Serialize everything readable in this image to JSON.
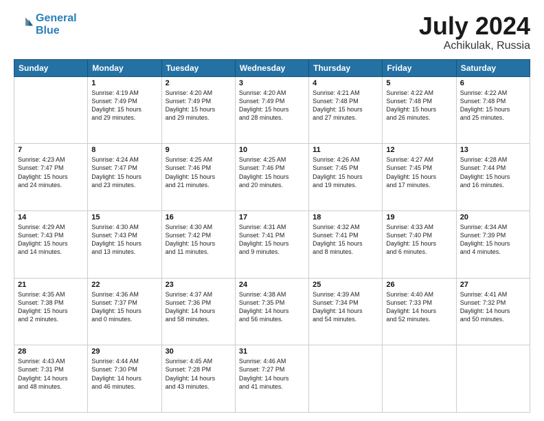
{
  "logo": {
    "line1": "General",
    "line2": "Blue"
  },
  "title": "July 2024",
  "subtitle": "Achikulak, Russia",
  "days_of_week": [
    "Sunday",
    "Monday",
    "Tuesday",
    "Wednesday",
    "Thursday",
    "Friday",
    "Saturday"
  ],
  "weeks": [
    [
      {
        "day": "",
        "info": ""
      },
      {
        "day": "1",
        "info": "Sunrise: 4:19 AM\nSunset: 7:49 PM\nDaylight: 15 hours\nand 29 minutes."
      },
      {
        "day": "2",
        "info": "Sunrise: 4:20 AM\nSunset: 7:49 PM\nDaylight: 15 hours\nand 29 minutes."
      },
      {
        "day": "3",
        "info": "Sunrise: 4:20 AM\nSunset: 7:49 PM\nDaylight: 15 hours\nand 28 minutes."
      },
      {
        "day": "4",
        "info": "Sunrise: 4:21 AM\nSunset: 7:48 PM\nDaylight: 15 hours\nand 27 minutes."
      },
      {
        "day": "5",
        "info": "Sunrise: 4:22 AM\nSunset: 7:48 PM\nDaylight: 15 hours\nand 26 minutes."
      },
      {
        "day": "6",
        "info": "Sunrise: 4:22 AM\nSunset: 7:48 PM\nDaylight: 15 hours\nand 25 minutes."
      }
    ],
    [
      {
        "day": "7",
        "info": "Sunrise: 4:23 AM\nSunset: 7:47 PM\nDaylight: 15 hours\nand 24 minutes."
      },
      {
        "day": "8",
        "info": "Sunrise: 4:24 AM\nSunset: 7:47 PM\nDaylight: 15 hours\nand 23 minutes."
      },
      {
        "day": "9",
        "info": "Sunrise: 4:25 AM\nSunset: 7:46 PM\nDaylight: 15 hours\nand 21 minutes."
      },
      {
        "day": "10",
        "info": "Sunrise: 4:25 AM\nSunset: 7:46 PM\nDaylight: 15 hours\nand 20 minutes."
      },
      {
        "day": "11",
        "info": "Sunrise: 4:26 AM\nSunset: 7:45 PM\nDaylight: 15 hours\nand 19 minutes."
      },
      {
        "day": "12",
        "info": "Sunrise: 4:27 AM\nSunset: 7:45 PM\nDaylight: 15 hours\nand 17 minutes."
      },
      {
        "day": "13",
        "info": "Sunrise: 4:28 AM\nSunset: 7:44 PM\nDaylight: 15 hours\nand 16 minutes."
      }
    ],
    [
      {
        "day": "14",
        "info": "Sunrise: 4:29 AM\nSunset: 7:43 PM\nDaylight: 15 hours\nand 14 minutes."
      },
      {
        "day": "15",
        "info": "Sunrise: 4:30 AM\nSunset: 7:43 PM\nDaylight: 15 hours\nand 13 minutes."
      },
      {
        "day": "16",
        "info": "Sunrise: 4:30 AM\nSunset: 7:42 PM\nDaylight: 15 hours\nand 11 minutes."
      },
      {
        "day": "17",
        "info": "Sunrise: 4:31 AM\nSunset: 7:41 PM\nDaylight: 15 hours\nand 9 minutes."
      },
      {
        "day": "18",
        "info": "Sunrise: 4:32 AM\nSunset: 7:41 PM\nDaylight: 15 hours\nand 8 minutes."
      },
      {
        "day": "19",
        "info": "Sunrise: 4:33 AM\nSunset: 7:40 PM\nDaylight: 15 hours\nand 6 minutes."
      },
      {
        "day": "20",
        "info": "Sunrise: 4:34 AM\nSunset: 7:39 PM\nDaylight: 15 hours\nand 4 minutes."
      }
    ],
    [
      {
        "day": "21",
        "info": "Sunrise: 4:35 AM\nSunset: 7:38 PM\nDaylight: 15 hours\nand 2 minutes."
      },
      {
        "day": "22",
        "info": "Sunrise: 4:36 AM\nSunset: 7:37 PM\nDaylight: 15 hours\nand 0 minutes."
      },
      {
        "day": "23",
        "info": "Sunrise: 4:37 AM\nSunset: 7:36 PM\nDaylight: 14 hours\nand 58 minutes."
      },
      {
        "day": "24",
        "info": "Sunrise: 4:38 AM\nSunset: 7:35 PM\nDaylight: 14 hours\nand 56 minutes."
      },
      {
        "day": "25",
        "info": "Sunrise: 4:39 AM\nSunset: 7:34 PM\nDaylight: 14 hours\nand 54 minutes."
      },
      {
        "day": "26",
        "info": "Sunrise: 4:40 AM\nSunset: 7:33 PM\nDaylight: 14 hours\nand 52 minutes."
      },
      {
        "day": "27",
        "info": "Sunrise: 4:41 AM\nSunset: 7:32 PM\nDaylight: 14 hours\nand 50 minutes."
      }
    ],
    [
      {
        "day": "28",
        "info": "Sunrise: 4:43 AM\nSunset: 7:31 PM\nDaylight: 14 hours\nand 48 minutes."
      },
      {
        "day": "29",
        "info": "Sunrise: 4:44 AM\nSunset: 7:30 PM\nDaylight: 14 hours\nand 46 minutes."
      },
      {
        "day": "30",
        "info": "Sunrise: 4:45 AM\nSunset: 7:28 PM\nDaylight: 14 hours\nand 43 minutes."
      },
      {
        "day": "31",
        "info": "Sunrise: 4:46 AM\nSunset: 7:27 PM\nDaylight: 14 hours\nand 41 minutes."
      },
      {
        "day": "",
        "info": ""
      },
      {
        "day": "",
        "info": ""
      },
      {
        "day": "",
        "info": ""
      }
    ]
  ]
}
